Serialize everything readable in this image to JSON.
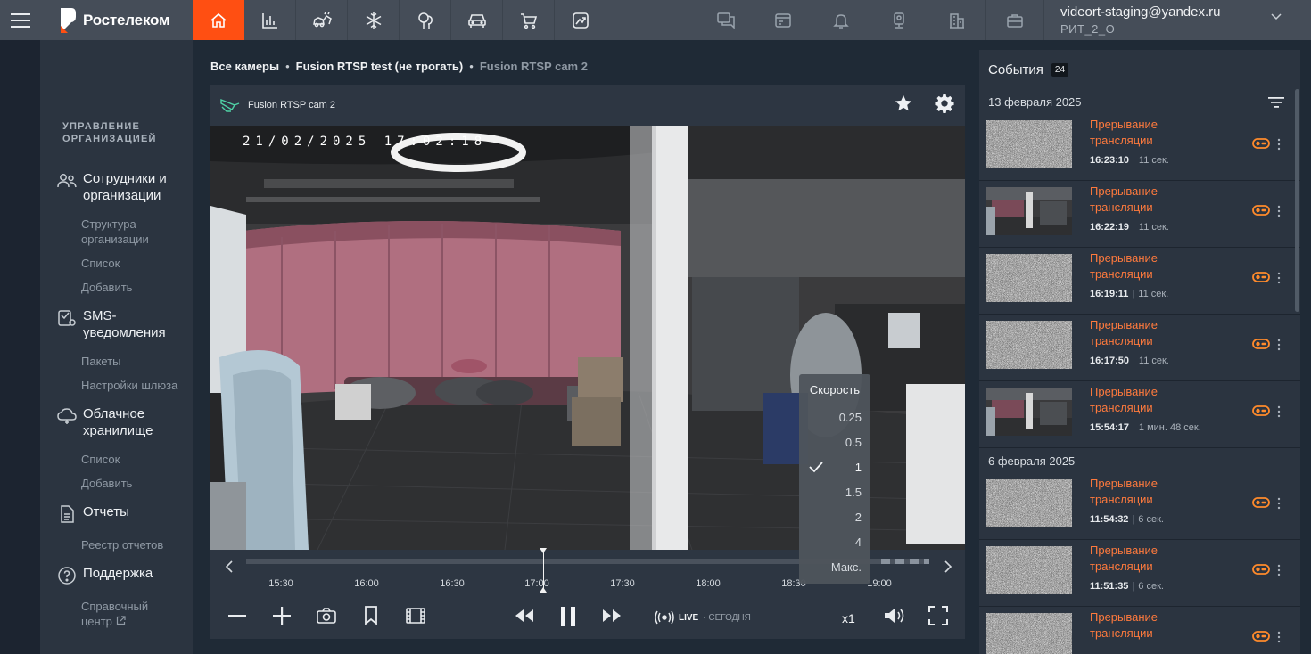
{
  "brand": {
    "name": "Ростелеком",
    "accent": "#ff4f12"
  },
  "topnav": {
    "left_icons": [
      "home-icon",
      "chart-icon",
      "car-crash-icon",
      "snowflake-icon",
      "trees-icon",
      "car-icon",
      "cart-icon",
      "trend-icon"
    ],
    "right_icons": [
      "chat-icon",
      "card-icon",
      "bell-icon",
      "camera-device-icon",
      "building-icon",
      "briefcase-icon"
    ]
  },
  "user": {
    "email": "videort-staging@yandex.ru",
    "org": "РИТ_2_О"
  },
  "sidebar": {
    "heading_line1": "УПРАВЛЕНИЕ",
    "heading_line2": "ОРГАНИЗАЦИЕЙ",
    "sections": [
      {
        "title_line1": "Сотрудники и",
        "title_line2": "организации",
        "items": [
          "Структура организации",
          "Список",
          "Добавить"
        ]
      },
      {
        "title_line1": "SMS-",
        "title_line2": "уведомления",
        "items": [
          "Пакеты",
          "Настройки шлюза"
        ]
      },
      {
        "title_line1": "Облачное",
        "title_line2": "хранилище",
        "items": [
          "Список",
          "Добавить"
        ]
      },
      {
        "title_line1": "Отчеты",
        "title_line2": "",
        "items": [
          "Реестр отчетов"
        ]
      },
      {
        "title_line1": "Поддержка",
        "title_line2": "",
        "items": [
          "Справочный центр"
        ]
      }
    ]
  },
  "breadcrumb": {
    "root": "Все камеры",
    "folder": "Fusion RTSP test (не трогать)",
    "current": "Fusion RTSP cam 2",
    "sep": "•"
  },
  "player": {
    "camera_name": "Fusion RTSP cam 2",
    "osd_timestamp": "21/02/2025 17:02:18",
    "timeline_labels": [
      "15:30",
      "16:00",
      "16:30",
      "17:00",
      "17:30",
      "18:00",
      "18:30",
      "19:00"
    ],
    "live_label": "LIVE",
    "live_sub": "· СЕГОДНЯ",
    "speed_value": "x1",
    "speed_menu": {
      "title": "Скорость",
      "options": [
        "0.25",
        "0.5",
        "1",
        "1.5",
        "2",
        "4",
        "Макс."
      ],
      "selected": "1"
    }
  },
  "events": {
    "title": "События",
    "count": "24",
    "groups": [
      {
        "date": "13 февраля 2025",
        "items": [
          {
            "type_line1": "Прерывание",
            "type_line2": "трансляции",
            "time": "16:23:10",
            "duration": "11 сек.",
            "thumb": "noise"
          },
          {
            "type_line1": "Прерывание",
            "type_line2": "трансляции",
            "time": "16:22:19",
            "duration": "11 сек.",
            "thumb": "office"
          },
          {
            "type_line1": "Прерывание",
            "type_line2": "трансляции",
            "time": "16:19:11",
            "duration": "11 сек.",
            "thumb": "noise"
          },
          {
            "type_line1": "Прерывание",
            "type_line2": "трансляции",
            "time": "16:17:50",
            "duration": "11 сек.",
            "thumb": "noise"
          },
          {
            "type_line1": "Прерывание",
            "type_line2": "трансляции",
            "time": "15:54:17",
            "duration": "1 мин. 48 сек.",
            "thumb": "office"
          }
        ]
      },
      {
        "date": "6 февраля 2025",
        "items": [
          {
            "type_line1": "Прерывание",
            "type_line2": "трансляции",
            "time": "11:54:32",
            "duration": "6 сек.",
            "thumb": "noise"
          },
          {
            "type_line1": "Прерывание",
            "type_line2": "трансляции",
            "time": "11:51:35",
            "duration": "6 сек.",
            "thumb": "noise"
          },
          {
            "type_line1": "Прерывание",
            "type_line2": "трансляции",
            "time": "",
            "duration": "",
            "thumb": "noise"
          }
        ]
      }
    ]
  }
}
